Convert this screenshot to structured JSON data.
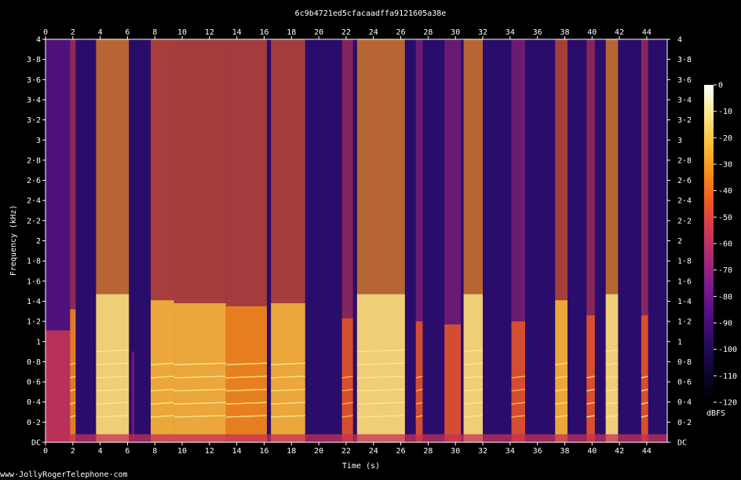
{
  "chart_data": {
    "type": "heatmap",
    "title": "6c9b4721ed5cfacaadffa9121605a38e",
    "xlabel": "Time (s)",
    "ylabel": "Frequency (kHz)",
    "xlim": [
      0,
      45.5
    ],
    "ylim": [
      0,
      4
    ],
    "x_ticks": [
      "0",
      "2",
      "4",
      "6",
      "8",
      "10",
      "12",
      "14",
      "16",
      "18",
      "20",
      "22",
      "24",
      "26",
      "28",
      "30",
      "32",
      "34",
      "36",
      "38",
      "40",
      "42",
      "44"
    ],
    "y_ticks": [
      "DC",
      "0·2",
      "0·4",
      "0·6",
      "0·8",
      "1",
      "1·2",
      "1·4",
      "1·6",
      "1·8",
      "2",
      "2·2",
      "2·4",
      "2·6",
      "2·8",
      "3",
      "3·2",
      "3·4",
      "3·6",
      "3·8",
      "4"
    ],
    "colorbar": {
      "label": "dBFS",
      "ticks": [
        "0",
        "-10",
        "-20",
        "-30",
        "-40",
        "-50",
        "-60",
        "-70",
        "-80",
        "-90",
        "-100",
        "-110",
        "-120"
      ],
      "range": [
        -120,
        0
      ],
      "colors": [
        "#000000",
        "#0b0530",
        "#280a60",
        "#520d84",
        "#7c1a8c",
        "#a8287a",
        "#d13a52",
        "#ee5a22",
        "#f9901a",
        "#fcc23c",
        "#fde98a",
        "#ffffff"
      ]
    },
    "segments": [
      {
        "start": 0.0,
        "end": 1.8,
        "level": 0.35
      },
      {
        "start": 1.8,
        "end": 2.2,
        "level": 0.7
      },
      {
        "start": 3.7,
        "end": 6.1,
        "level": 0.95
      },
      {
        "start": 6.3,
        "end": 6.5,
        "level": 0.0
      },
      {
        "start": 7.7,
        "end": 9.4,
        "level": 0.85
      },
      {
        "start": 9.4,
        "end": 13.2,
        "level": 0.8
      },
      {
        "start": 13.2,
        "end": 16.2,
        "level": 0.75
      },
      {
        "start": 16.5,
        "end": 19.0,
        "level": 0.8
      },
      {
        "start": 21.7,
        "end": 22.5,
        "level": 0.55
      },
      {
        "start": 22.8,
        "end": 26.3,
        "level": 0.95
      },
      {
        "start": 27.1,
        "end": 27.6,
        "level": 0.5
      },
      {
        "start": 29.2,
        "end": 30.4,
        "level": 0.45
      },
      {
        "start": 30.6,
        "end": 32.0,
        "level": 0.95
      },
      {
        "start": 34.1,
        "end": 35.1,
        "level": 0.5
      },
      {
        "start": 37.3,
        "end": 38.2,
        "level": 0.85
      },
      {
        "start": 39.6,
        "end": 40.2,
        "level": 0.6
      },
      {
        "start": 41.0,
        "end": 41.9,
        "level": 0.95
      },
      {
        "start": 43.6,
        "end": 44.1,
        "level": 0.6
      }
    ]
  },
  "footer": {
    "text": "www·JollyRogerTelephone·com"
  }
}
